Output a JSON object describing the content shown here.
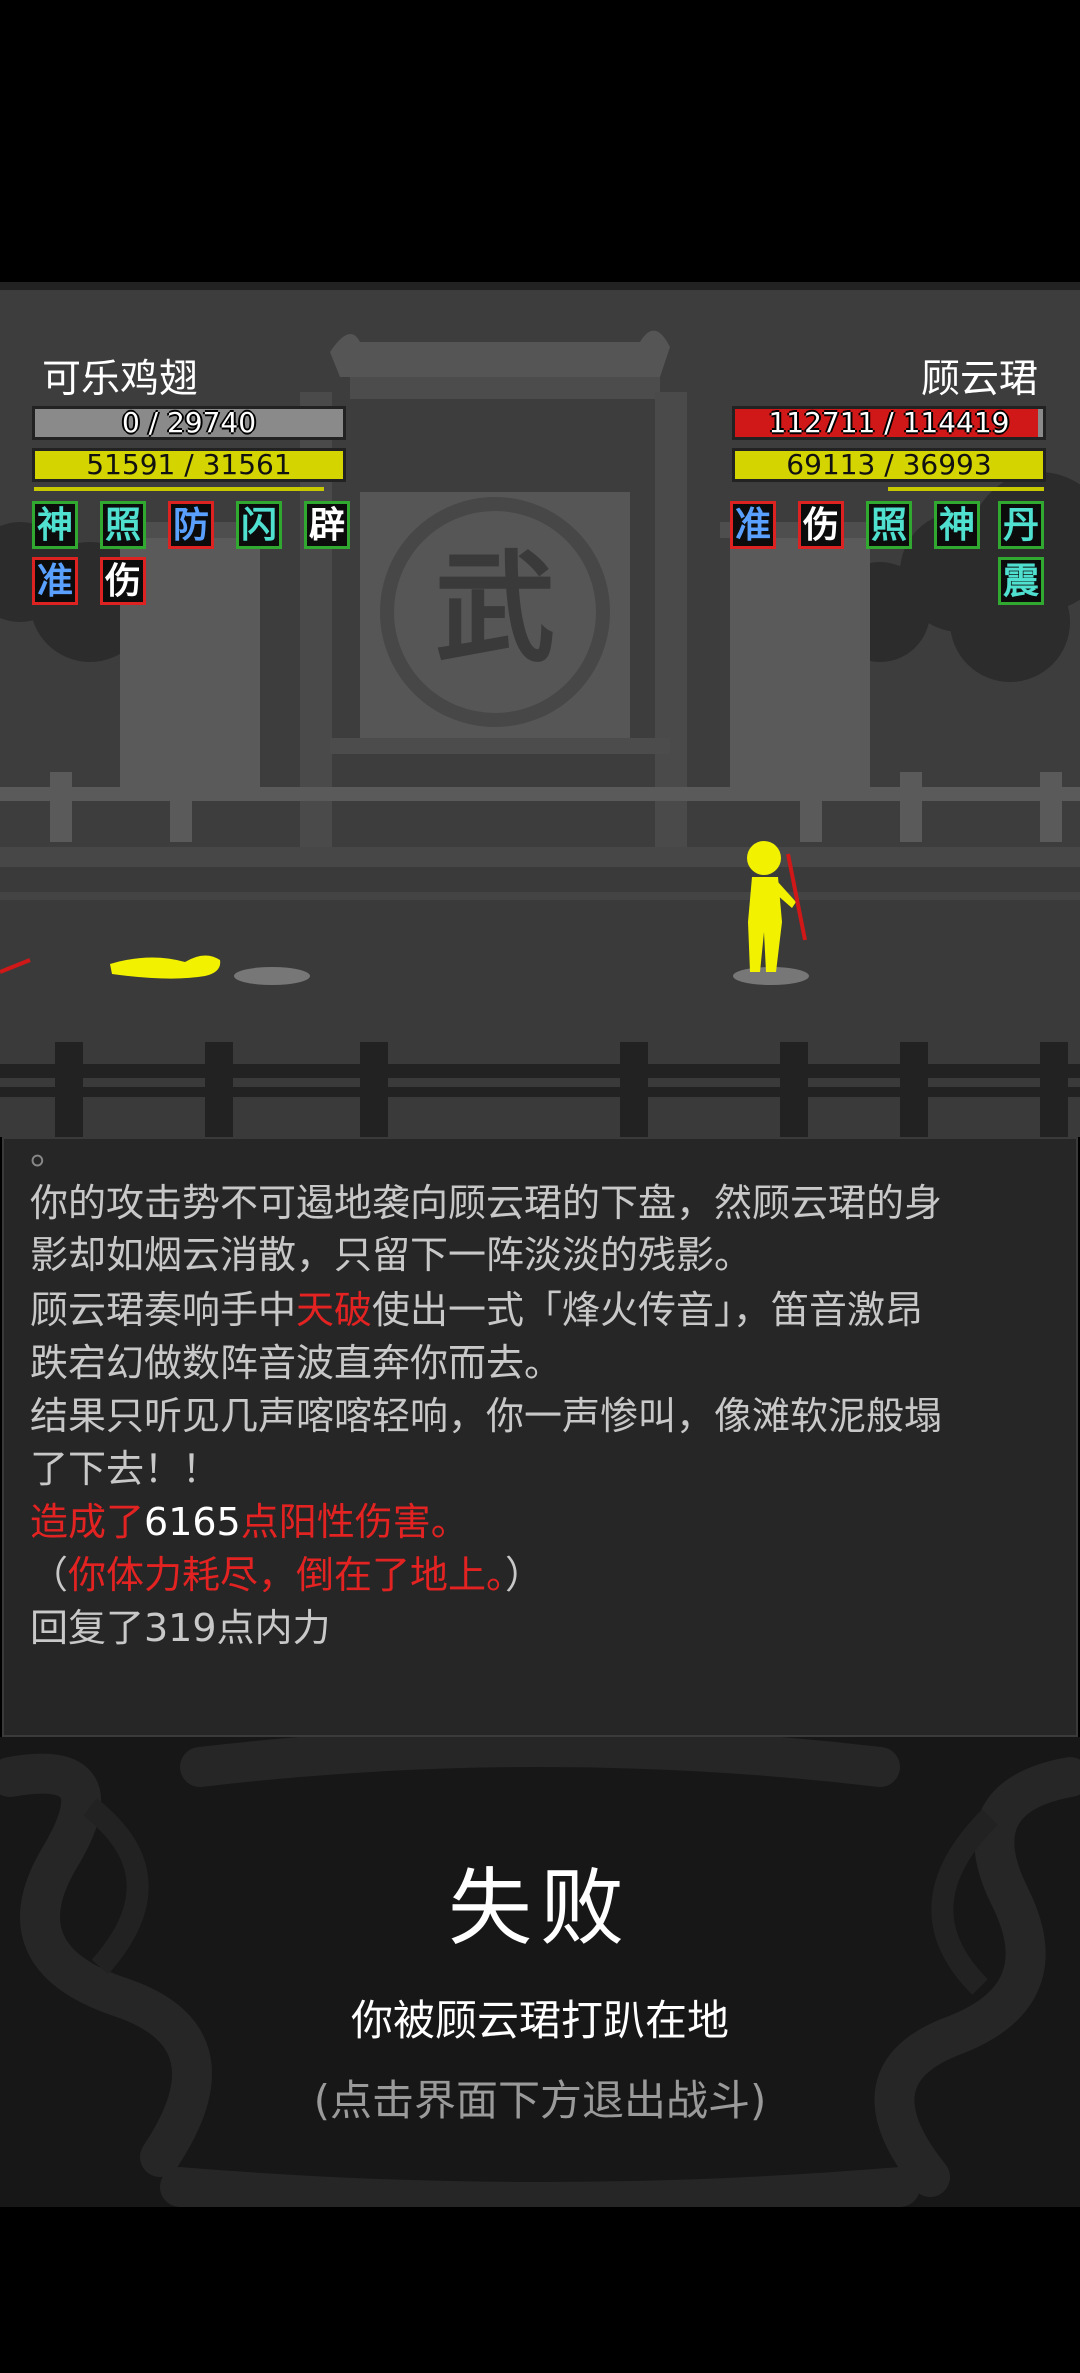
{
  "player": {
    "name": "可乐鸡翅",
    "hp_text": "0 / 29740",
    "hp_fraction": 0.0,
    "mp_text": "51591 / 31561",
    "mp_fraction": 1.0,
    "buffs_row1": [
      "神",
      "照",
      "防",
      "闪",
      "辟"
    ],
    "buffs_row2": [
      "准",
      "伤"
    ]
  },
  "enemy": {
    "name": "顾云珺",
    "hp_text": "112711 / 114419",
    "hp_fraction": 0.985,
    "mp_text": "69113 / 36993",
    "mp_fraction": 1.0,
    "buffs_row1": [
      "准",
      "伤",
      "照",
      "神",
      "丹"
    ],
    "buffs_row2": [
      "震"
    ]
  },
  "scene": {
    "gate_emblem": "武"
  },
  "log": {
    "cut_line": "。",
    "l1": "你的攻击势不可遏地袭向顾云珺的下盘，然顾云珺的身",
    "l2": "影却如烟云消散，只留下一阵淡淡的残影。",
    "l3_a": "顾云珺奏响手中",
    "l3_weapon": "天破",
    "l3_b": "使出一式「烽火传音」，笛音激昂",
    "l4": "跌宕幻做数阵音波直奔你而去。",
    "l5": "结果只听见几声喀喀轻响，你一声惨叫，像滩软泥般塌",
    "l6": "了下去！！",
    "l7_a": "造成了",
    "l7_num": "6165",
    "l7_b": "点阳性伤害。",
    "l8_a": "（",
    "l8_red": "你体力耗尽，倒在了地上。",
    "l8_b": "）",
    "l9": "回复了319点内力"
  },
  "result": {
    "title": "失败",
    "subtitle": "你被顾云珺打趴在地",
    "hint": "(点击界面下方退出战斗)"
  },
  "colors": {
    "hp_red": "#d01818",
    "hp_gray": "#8a8a8a",
    "mp_yellow": "#d4d400",
    "fighter_yellow": "#f2f200",
    "log_red": "#e32222"
  }
}
